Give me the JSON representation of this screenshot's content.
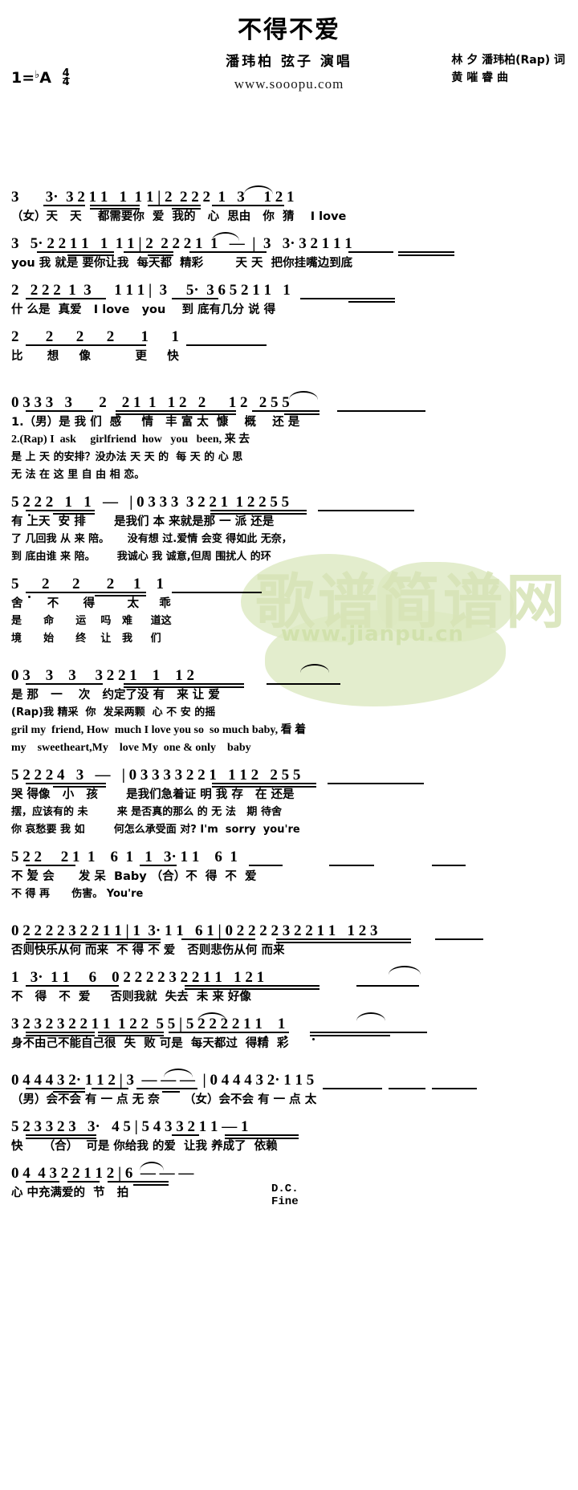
{
  "header": {
    "title": "不得不爱",
    "performers": "潘玮柏 弦子 演唱",
    "website": "www.sooopu.com",
    "credit_lyrics": "林 夕 潘玮柏(Rap) 词",
    "credit_music": "黄 嗺 睿 曲",
    "key_prefix": "1=",
    "key_accidental": "♭",
    "key_letter": "A",
    "time_num": "4",
    "time_den": "4"
  },
  "watermarks": {
    "big": "歌谱简谱网",
    "small": "www.jianpu.cn"
  },
  "markings": {
    "dc": "D.C.",
    "fine": "Fine",
    "verse1_num": "1.",
    "verse2_num": "2.(Rap) I"
  },
  "score": {
    "lines": [
      {
        "id": "l1",
        "notes": "3       3·  3 2 1 1   1  1 1 | 2  2 2 2  1   3     1 2 1",
        "lyrics": [
          "（女）天   天    都需要你  爱  我的   心  思由   你  猜    I love"
        ]
      },
      {
        "id": "l2",
        "notes": "3   5· 2 2 1 1   1  1 1 | 2  2 2 2 1  1   —  |  3   3· 3 2 1 1 1",
        "lyrics": [
          "you 我 就是 要你让我  每天都  精彩        天 天  把你挂嘴边到底"
        ]
      },
      {
        "id": "l3",
        "notes": "2   2 2 2  1  3      1 1 1 |  3     5·  3 6 5 2 1 1   1",
        "lyrics": [
          "什 么是  真爱   I love   you    到 底有几分 说 得"
        ]
      },
      {
        "id": "l4",
        "notes": "2       2      2      2       1      1",
        "lyrics": [
          "比      想     像           更     快"
        ]
      },
      {
        "id": "l5",
        "notes": "0 3 3 3   3       2    2 1  1   1 2   2      1 2   2 5 5",
        "lyrics": [
          "1.（男）是 我 们  感     情   丰 富 太  慷    概    还 是",
          "2.(Rap) I  ask     girlfriend  how   you   been, 来 去",
          "是 上 天 的安排？没办法 天 天 的  每 天 的 心 思",
          "无 法 在 这 里 自 由 相 恋。"
        ]
      },
      {
        "id": "l6",
        "notes": "5 2 2 2   1   1   —   | 0 3 3 3  3 2 2 1  1 2 2 5 5",
        "lyrics": [
          "有 上天  安 排       是我们 本 来就是那 一 派 还是",
          "了 几回我 从 来 陪。     没有想 过.爱情 会变 得如此 无奈，",
          "到 底由谁 来 陪。      我诚心 我 诚意,但周 围扰人 的环"
        ]
      },
      {
        "id": "l7",
        "notes": "5      2      2       2     1    1",
        "lyrics": [
          "舍      不      得        太     乖",
          "是      命      运    吗   难     道这",
          "境      始      终    让   我     们"
        ]
      },
      {
        "id": "l8",
        "notes": "0 3    3    3     3 2 2 1    1    1 2",
        "lyrics": [
          "是 那   一    次   约定了没 有   来 让 爱",
          "(Rap)我 精采  你  发呆两颗  心 不 安 的摇",
          "gril my  friend, How  much I love you so  so much baby, 看 着",
          "my    sweetheart,My    love My  one & only    baby"
        ]
      },
      {
        "id": "l9",
        "notes": "5 2 2 2 4   3   —   | 0 3 3 3 3 2 2 1   1 1 2   2 5 5",
        "lyrics": [
          "哭 得像   小   孩       是我们急着证 明 我 存   在 还是",
          "摆，应该有的 未        来 是否真的那么 的 无 法   期 待舍",
          "你 哀愁要 我 如        何怎么承受面 对? I'm  sorry  you're"
        ]
      },
      {
        "id": "l10",
        "notes": "5 2 2     2 1  1    6  1   1   3· 1 1    6  1",
        "lyrics": [
          "不 爱 会      发 呆  Baby （合）不  得  不  爱",
          "不 得 再      伤害。 You're"
        ]
      },
      {
        "id": "l11",
        "notes": "0 2 2 2 2 3 2 2 1 1 | 1  3· 1 1   6 1 | 0 2 2 2 2 3 2 2 1 1   1 2 3",
        "lyrics": [
          "否则快乐从何 而来  不 得 不 爱   否则悲伤从何 而来"
        ]
      },
      {
        "id": "l12",
        "notes": "1   3·  1 1     6    0 2 2 2 2 3 2 2 1 1   1 2 1",
        "lyrics": [
          "不   得   不  爱     否则我就  失去  未 来 好像"
        ]
      },
      {
        "id": "l13",
        "notes": "3 2 3 2 3 2 2 1 1  1 2 2  5 5 | 5 2 2 2 2 1 1    1",
        "lyrics": [
          "身不由己不能自己很  失  败 可是  每天都过  得精  彩"
        ]
      },
      {
        "id": "l14",
        "notes": "0 4 4 4 3 2· 1 1 2 | 3  — — —  | 0 4 4 4 3 2· 1 1 5",
        "lyrics": [
          "（男）会不会 有 一 点 无 奈      （女）会不会 有 一 点 太"
        ]
      },
      {
        "id": "l15",
        "notes": "5 2 3 3 2 3   3·   4 5 | 5 4 3 3 2 1 1 — 1",
        "lyrics": [
          "快     （合）  可是 你给我 的爱  让我 养成了  依赖"
        ]
      },
      {
        "id": "l16",
        "notes": "0 4  4 3 2 2 1 1 2 | 6  — — —",
        "lyrics": [
          "心 中充满爱的  节   拍"
        ]
      }
    ]
  }
}
